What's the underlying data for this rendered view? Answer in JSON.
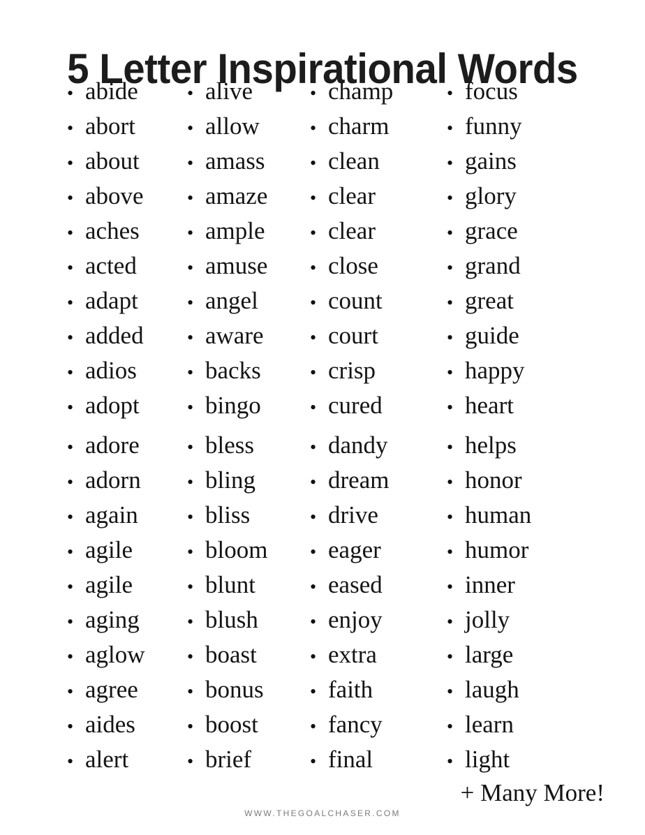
{
  "page": {
    "title": "5 Letter Inspirational Words",
    "background_color": "#ffffff",
    "text_color": "#141414"
  },
  "bullet_glyph": "•",
  "columns": [
    {
      "id": "column-1",
      "blocks": [
        {
          "id": "block-a",
          "words": [
            "abide",
            "abort",
            "about",
            "above",
            "aches",
            "acted",
            "adapt",
            "added",
            "adios",
            "adopt"
          ]
        },
        {
          "id": "block-b",
          "words": [
            "adore",
            "adorn",
            "again",
            "agile",
            "agile",
            "aging",
            "aglow",
            "agree",
            "aides",
            "alert"
          ]
        }
      ]
    },
    {
      "id": "column-2",
      "blocks": [
        {
          "id": "block-a",
          "words": [
            "alive",
            "allow",
            "amass",
            "amaze",
            "ample",
            "amuse",
            "angel",
            "aware",
            "backs",
            "bingo"
          ]
        },
        {
          "id": "block-b",
          "words": [
            "bless",
            "bling",
            "bliss",
            "bloom",
            "blunt",
            "blush",
            "boast",
            "bonus",
            "boost",
            "brief"
          ]
        }
      ]
    },
    {
      "id": "column-3",
      "blocks": [
        {
          "id": "block-a",
          "words": [
            "champ",
            "charm",
            "clean",
            "clear",
            "clear",
            "close",
            "count",
            "court",
            "crisp",
            "cured"
          ]
        },
        {
          "id": "block-b",
          "words": [
            "dandy",
            "dream",
            "drive",
            "eager",
            "eased",
            "enjoy",
            "extra",
            "faith",
            "fancy",
            "final"
          ]
        }
      ]
    },
    {
      "id": "column-4",
      "blocks": [
        {
          "id": "block-a",
          "words": [
            "focus",
            "funny",
            "gains",
            "glory",
            "grace",
            "grand",
            "great",
            "guide",
            "happy",
            "heart"
          ]
        },
        {
          "id": "block-b",
          "words": [
            "helps",
            "honor",
            "human",
            "humor",
            "inner",
            "jolly",
            "large",
            "laugh",
            "learn",
            "light"
          ]
        }
      ]
    }
  ],
  "many_more": "+ Many More!",
  "footer": {
    "url": "WWW.THEGOALCHASER.COM",
    "color": "#7b7b7b"
  }
}
